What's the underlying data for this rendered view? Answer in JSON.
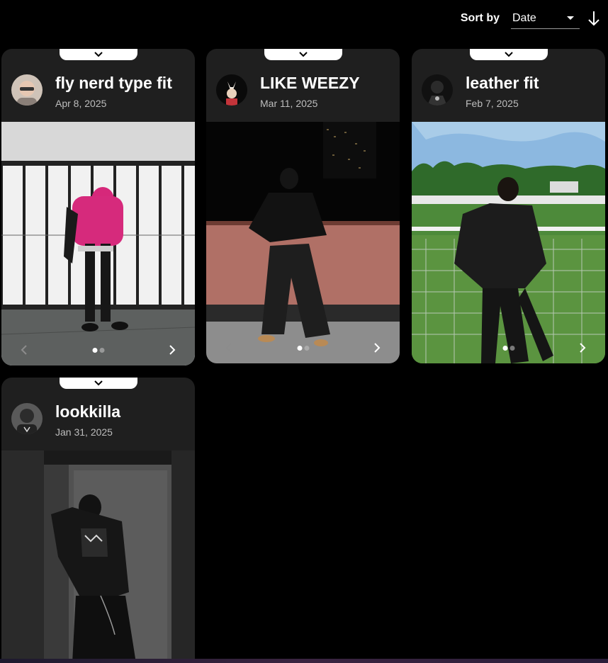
{
  "sort": {
    "label": "Sort by",
    "value": "Date"
  },
  "posts": [
    {
      "title": "fly nerd type fit",
      "date": "Apr 8, 2025",
      "images": 2,
      "current": 1
    },
    {
      "title": "LIKE WEEZY",
      "date": "Mar 11, 2025",
      "images": 2,
      "current": 1
    },
    {
      "title": "leather fit",
      "date": "Feb 7, 2025",
      "images": 2,
      "current": 1
    },
    {
      "title": "lookkilla",
      "date": "Jan 31, 2025"
    }
  ]
}
